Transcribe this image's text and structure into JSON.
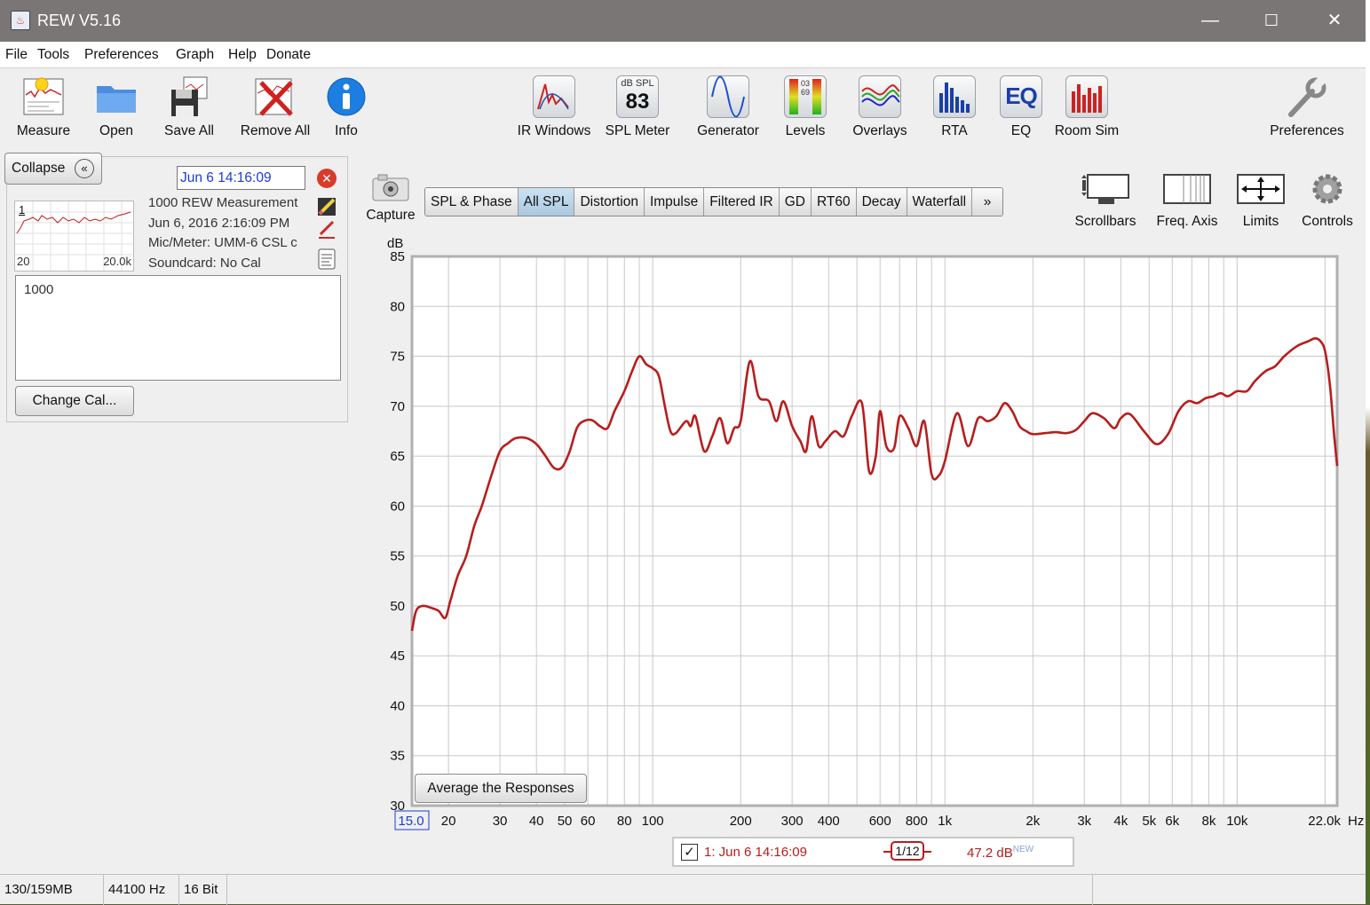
{
  "window": {
    "title": "REW V5.16",
    "minimize": "—",
    "maximize": "☐",
    "close": "✕"
  },
  "menu": [
    "File",
    "Tools",
    "Preferences",
    "Graph",
    "Help",
    "Donate"
  ],
  "toolbar": {
    "left": [
      "Measure",
      "Open",
      "Save All",
      "Remove All",
      "Info"
    ],
    "center": [
      "IR Windows",
      "SPL Meter",
      "Generator",
      "Levels",
      "Overlays",
      "RTA",
      "EQ",
      "Room Sim"
    ],
    "right": "Preferences",
    "spl_meter_caption": "dB SPL",
    "spl_meter_value": "83",
    "eq_icon_text": "EQ",
    "levels_digits": "0369"
  },
  "panel": {
    "collapse_label": "Collapse",
    "collapse_icon": "«",
    "date_value": "Jun 6 14:16:09",
    "thumb_index": "1",
    "thumb_xmin": "20",
    "thumb_xmax": "20.0k",
    "name": "1000 REW Measurement",
    "timestamp": "Jun 6, 2016 2:16:09 PM",
    "mic": "Mic/Meter: UMM-6 CSL c",
    "soundcard": "Soundcard: No Cal",
    "notes": "1000",
    "change_cal": "Change Cal..."
  },
  "graph": {
    "capture": "Capture",
    "tabs": [
      "SPL & Phase",
      "All SPL",
      "Distortion",
      "Impulse",
      "Filtered IR",
      "GD",
      "RT60",
      "Decay",
      "Waterfall",
      "»"
    ],
    "active_tab": "All SPL",
    "tools": [
      "Scrollbars",
      "Freq. Axis",
      "Limits",
      "Controls"
    ],
    "average_btn": "Average the Responses",
    "unit_label": "dB",
    "x_unit": "Hz"
  },
  "legend": {
    "checked": true,
    "check_mark": "✓",
    "label": "1: Jun 6 14:16:09",
    "smoothing": "1/12",
    "level": "47.2 dB",
    "level_tag": "NEW"
  },
  "status": [
    "130/159MB",
    "44100 Hz",
    "16 Bit"
  ],
  "colors": {
    "trace": "#b81d1d",
    "grid": "#c8c8c8",
    "left_axis": "#2424d8"
  },
  "chart_data": {
    "type": "line",
    "xscale": "log",
    "xlim": [
      15,
      22000
    ],
    "ylim": [
      30,
      85
    ],
    "ylabel": "dB",
    "xlabel": "Hz",
    "yticks": [
      30,
      35,
      40,
      45,
      50,
      55,
      60,
      65,
      70,
      75,
      80,
      85
    ],
    "xticks": [
      {
        "v": 15,
        "label": "15.0"
      },
      {
        "v": 20,
        "label": "20"
      },
      {
        "v": 30,
        "label": "30"
      },
      {
        "v": 40,
        "label": "40"
      },
      {
        "v": 50,
        "label": "50"
      },
      {
        "v": 60,
        "label": "60"
      },
      {
        "v": 80,
        "label": "80"
      },
      {
        "v": 100,
        "label": "100"
      },
      {
        "v": 200,
        "label": "200"
      },
      {
        "v": 300,
        "label": "300"
      },
      {
        "v": 400,
        "label": "400"
      },
      {
        "v": 600,
        "label": "600"
      },
      {
        "v": 800,
        "label": "800"
      },
      {
        "v": 1000,
        "label": "1k"
      },
      {
        "v": 2000,
        "label": "2k"
      },
      {
        "v": 3000,
        "label": "3k"
      },
      {
        "v": 4000,
        "label": "4k"
      },
      {
        "v": 5000,
        "label": "5k"
      },
      {
        "v": 6000,
        "label": "6k"
      },
      {
        "v": 8000,
        "label": "8k"
      },
      {
        "v": 10000,
        "label": "10k"
      },
      {
        "v": 22000,
        "label": "22.0k"
      }
    ],
    "grid": true,
    "series": [
      {
        "name": "1: Jun 6 14:16:09",
        "points": [
          [
            15,
            47.5
          ],
          [
            15.5,
            49.5
          ],
          [
            16.3,
            50
          ],
          [
            17.5,
            49.8
          ],
          [
            18.5,
            49.5
          ],
          [
            19.5,
            48.8
          ],
          [
            20.3,
            50.5
          ],
          [
            21.5,
            53
          ],
          [
            23,
            55
          ],
          [
            24.5,
            58
          ],
          [
            26,
            60
          ],
          [
            28,
            63
          ],
          [
            30,
            65.5
          ],
          [
            32,
            66.3
          ],
          [
            34,
            66.8
          ],
          [
            37,
            66.8
          ],
          [
            40,
            66.2
          ],
          [
            43,
            65
          ],
          [
            46,
            63.8
          ],
          [
            49,
            63.9
          ],
          [
            52,
            65.5
          ],
          [
            55,
            67.8
          ],
          [
            58,
            68.5
          ],
          [
            62,
            68.6
          ],
          [
            66,
            68
          ],
          [
            70,
            67.8
          ],
          [
            74,
            69.5
          ],
          [
            80,
            71.5
          ],
          [
            85,
            73.5
          ],
          [
            90,
            75
          ],
          [
            95,
            74.2
          ],
          [
            100,
            73.8
          ],
          [
            105,
            73
          ],
          [
            110,
            70
          ],
          [
            115,
            67.5
          ],
          [
            120,
            67.3
          ],
          [
            130,
            68.5
          ],
          [
            135,
            68
          ],
          [
            140,
            69
          ],
          [
            150,
            65.5
          ],
          [
            160,
            67
          ],
          [
            170,
            68.8
          ],
          [
            180,
            66.3
          ],
          [
            190,
            67.8
          ],
          [
            200,
            68.5
          ],
          [
            215,
            74.5
          ],
          [
            230,
            71
          ],
          [
            250,
            70.5
          ],
          [
            265,
            68.5
          ],
          [
            280,
            70.5
          ],
          [
            300,
            68
          ],
          [
            320,
            66.5
          ],
          [
            335,
            65.5
          ],
          [
            350,
            69
          ],
          [
            370,
            66
          ],
          [
            390,
            66.5
          ],
          [
            420,
            67.5
          ],
          [
            450,
            67
          ],
          [
            480,
            69
          ],
          [
            520,
            70.3
          ],
          [
            550,
            63.5
          ],
          [
            580,
            65
          ],
          [
            600,
            69.5
          ],
          [
            630,
            66
          ],
          [
            670,
            65.8
          ],
          [
            700,
            69
          ],
          [
            750,
            67.8
          ],
          [
            800,
            66
          ],
          [
            850,
            68.5
          ],
          [
            900,
            63.2
          ],
          [
            950,
            63
          ],
          [
            1000,
            64.5
          ],
          [
            1100,
            69.3
          ],
          [
            1200,
            66
          ],
          [
            1300,
            68.8
          ],
          [
            1400,
            68.5
          ],
          [
            1500,
            69
          ],
          [
            1600,
            70.3
          ],
          [
            1700,
            69.5
          ],
          [
            1800,
            68
          ],
          [
            1900,
            67.5
          ],
          [
            2000,
            67.2
          ],
          [
            2200,
            67.3
          ],
          [
            2400,
            67.4
          ],
          [
            2600,
            67.3
          ],
          [
            2800,
            67.6
          ],
          [
            3000,
            68.5
          ],
          [
            3200,
            69.3
          ],
          [
            3500,
            68.8
          ],
          [
            3800,
            67.8
          ],
          [
            4000,
            68.8
          ],
          [
            4300,
            69.2
          ],
          [
            4800,
            67.5
          ],
          [
            5300,
            66.2
          ],
          [
            5800,
            67.2
          ],
          [
            6300,
            69.5
          ],
          [
            6800,
            70.5
          ],
          [
            7300,
            70.3
          ],
          [
            7800,
            70.8
          ],
          [
            8300,
            71
          ],
          [
            8800,
            71.3
          ],
          [
            9300,
            71
          ],
          [
            10000,
            71.5
          ],
          [
            10800,
            71.5
          ],
          [
            11500,
            72.5
          ],
          [
            12500,
            73.5
          ],
          [
            13500,
            74
          ],
          [
            14500,
            75
          ],
          [
            16000,
            76
          ],
          [
            17500,
            76.5
          ],
          [
            18500,
            76.8
          ],
          [
            19300,
            76.5
          ],
          [
            20000,
            75.5
          ],
          [
            20800,
            72
          ],
          [
            21500,
            67
          ],
          [
            22000,
            64
          ]
        ]
      }
    ]
  }
}
